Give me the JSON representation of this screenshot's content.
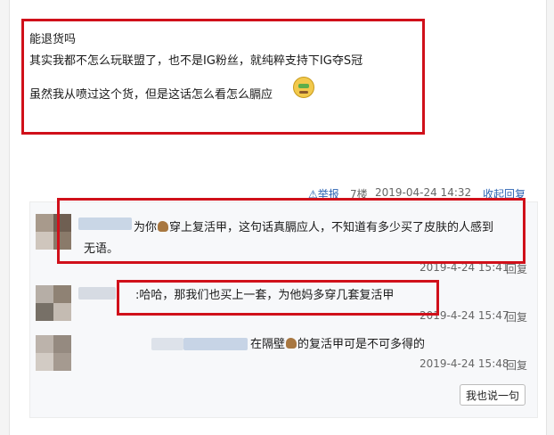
{
  "post": {
    "lines": [
      "能退货吗",
      "其实我都不怎么玩联盟了，也不是IG粉丝，就纯粹支持下IG夺S冠",
      "虽然我从喷过这个货，但是这话怎么看怎么膈应"
    ],
    "emoji_icon": "money-face-emoji-icon"
  },
  "meta": {
    "report_icon": "warning-triangle-icon",
    "report_label": "举报",
    "floor": "7楼",
    "timestamp": "2019-04-24 14:32",
    "collapse_label": "收起回复"
  },
  "replies": [
    {
      "text_before": "为你",
      "inline_icon": "horse-icon",
      "text_after": "穿上复活甲，这句话真膈应人，不知道有多少买了皮肤的人感到",
      "text_line2": "无语。",
      "time": "2019-4-24 15:41",
      "reply_label": "回复"
    },
    {
      "text": ":哈哈，那我们也买上一套，为他妈多穿几套复活甲",
      "time": "2019-4-24 15:47",
      "reply_label": "回复"
    },
    {
      "text_before": "在隔壁",
      "inline_icon": "horse-icon",
      "text_after": "的复活甲可是不可多得的",
      "time": "2019-4-24 15:48",
      "reply_label": "回复"
    }
  ],
  "reply_button_label": "我也说一句",
  "colors": {
    "highlight": "#d0101a",
    "link": "#2d64b3",
    "meta_text": "#666666"
  }
}
